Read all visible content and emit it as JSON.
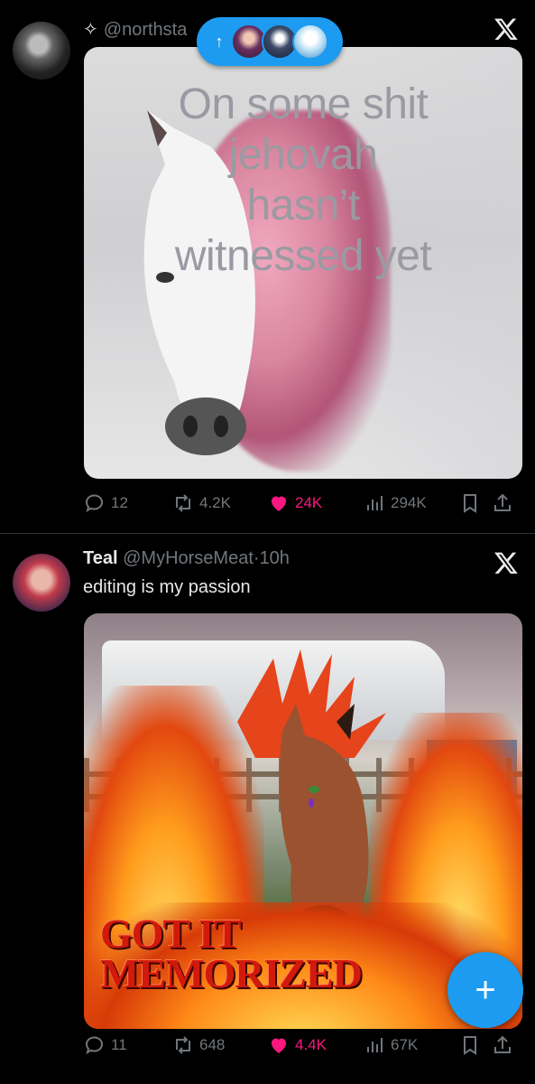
{
  "post1": {
    "handle": "@northsta",
    "meme_lines": [
      "On some shit",
      "jehovah",
      "hasn’t",
      "witnessed yet"
    ],
    "reply_count": "12",
    "retweet_count": "4.2K",
    "like_count": "24K",
    "view_count": "294K"
  },
  "new_posts_pill": {
    "arrow": "↑"
  },
  "post2": {
    "name": "Teal",
    "handle": "@MyHorseMeat",
    "separator": "·",
    "time": "10h",
    "text": "editing is my passion",
    "meme_lines": [
      "GOT IT",
      "MEMORIZED"
    ],
    "reply_count": "11",
    "retweet_count": "648",
    "like_count": "4.4K",
    "view_count": "67K"
  },
  "fab": {
    "label": "+"
  },
  "colors": {
    "accent": "#1d9bf0",
    "like": "#f91880",
    "muted": "#71767b"
  },
  "icons": [
    "sparkle-icon",
    "x-logo-icon",
    "reply-icon",
    "retweet-icon",
    "heart-icon",
    "views-icon",
    "bookmark-icon",
    "share-icon",
    "plus-icon"
  ]
}
